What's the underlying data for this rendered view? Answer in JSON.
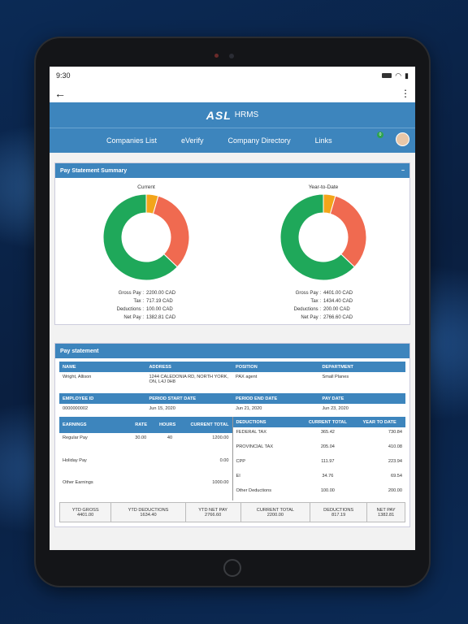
{
  "status": {
    "time": "9:30"
  },
  "app": {
    "logo": "ASL",
    "brand": "HRMS"
  },
  "nav": {
    "items": [
      "Companies List",
      "eVerify",
      "Company Directory",
      "Links"
    ],
    "notification_count": "0"
  },
  "summary": {
    "title": "Pay Statement Summary",
    "collapse_symbol": "−",
    "current": {
      "title": "Current",
      "labels": [
        "Gross Pay :",
        "Tax :",
        "Deductions :",
        "Net Pay :"
      ],
      "values": [
        "2200.00 CAD",
        "717.19 CAD",
        "100.00 CAD",
        "1382.81 CAD"
      ]
    },
    "ytd": {
      "title": "Year-to-Date",
      "labels": [
        "Gross Pay :",
        "Tax :",
        "Deductions :",
        "Net Pay :"
      ],
      "values": [
        "4401.00 CAD",
        "1434.40 CAD",
        "200.00 CAD",
        "2766.60 CAD"
      ]
    }
  },
  "chart_data": [
    {
      "type": "pie",
      "title": "Current",
      "categories": [
        "Tax",
        "Deductions",
        "Net Pay"
      ],
      "values": [
        717.19,
        100.0,
        1382.81
      ],
      "colors": [
        "#f06a50",
        "#f3a51a",
        "#1fa85a"
      ]
    },
    {
      "type": "pie",
      "title": "Year-to-Date",
      "categories": [
        "Tax",
        "Deductions",
        "Net Pay"
      ],
      "values": [
        1434.4,
        200.0,
        2766.6
      ],
      "colors": [
        "#f06a50",
        "#f3a51a",
        "#1fa85a"
      ]
    }
  ],
  "statement": {
    "title": "Pay statement",
    "info_headers": [
      "NAME",
      "ADDRESS",
      "POSITION",
      "DEPARTMENT"
    ],
    "info_values": [
      "Wright, Allison",
      "1244 CALEDONIA RD, NORTH YORK, ON, L4J 0H8",
      "PAX agent",
      "Small Planes"
    ],
    "period_headers": [
      "EMPLOYEE ID",
      "PERIOD START DATE",
      "PERIOD END DATE",
      "PAY DATE"
    ],
    "period_values": [
      "0000000002",
      "Jun 15, 2020",
      "Jun 21, 2020",
      "Jun 23, 2020"
    ],
    "earn_headers": [
      "EARNINGS",
      "RATE",
      "HOURS",
      "CURRENT TOTAL"
    ],
    "earnings": [
      {
        "name": "Regular Pay",
        "rate": "30.00",
        "hours": "40",
        "total": "1200.00"
      },
      {
        "name": "Holiday Pay",
        "rate": "",
        "hours": "",
        "total": "0.00"
      },
      {
        "name": "Other Earnings",
        "rate": "",
        "hours": "",
        "total": "1000.00"
      }
    ],
    "ded_headers": [
      "DEDUCTIONS",
      "CURRENT TOTAL",
      "YEAR TO DATE"
    ],
    "deductions": [
      {
        "name": "FEDERAL TAX",
        "current": "365.42",
        "ytd": "730.84"
      },
      {
        "name": "PROVINCIAL TAX",
        "current": "205.04",
        "ytd": "410.08"
      },
      {
        "name": "CPP",
        "current": "111.97",
        "ytd": "223.94"
      },
      {
        "name": "EI",
        "current": "34.76",
        "ytd": "69.54"
      },
      {
        "name": "Other Deductions",
        "current": "100.00",
        "ytd": "200.00"
      }
    ],
    "totals_headers": [
      "YTD GROSS",
      "YTD DEDUCTIONS",
      "YTD NET PAY",
      "CURRENT TOTAL",
      "DEDUCTIONS",
      "NET PAY"
    ],
    "totals_values": [
      "4401.00",
      "1634.40",
      "2766.60",
      "2200.00",
      "817.19",
      "1382.81"
    ]
  }
}
